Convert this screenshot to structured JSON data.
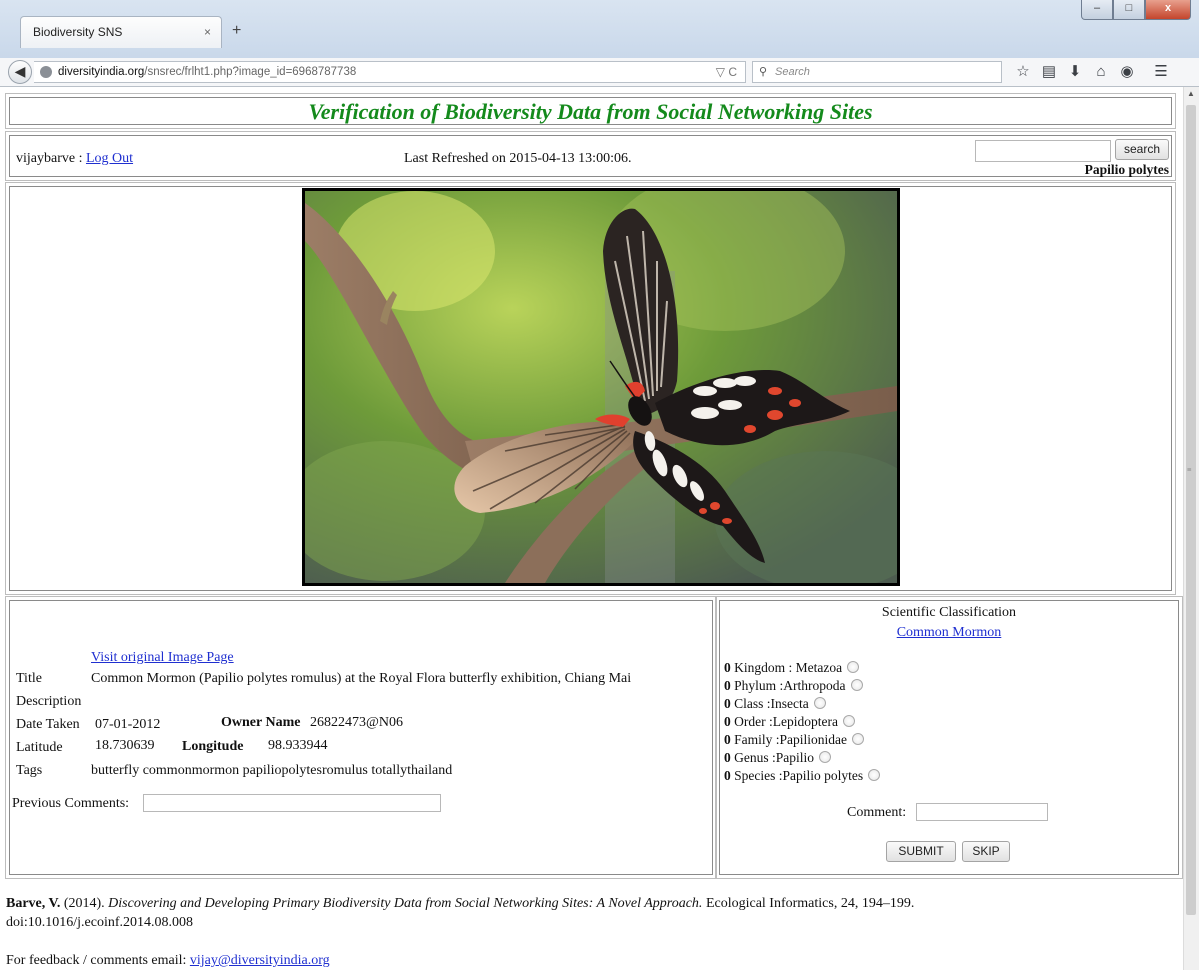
{
  "browser": {
    "tab_title": "Biodiversity SNS",
    "tab_close": "×",
    "new_tab": "+",
    "url_host": "diversityindia.org",
    "url_path": "/snsrec/frlht1.php?image_id=6968787738",
    "url_actions": "▽ C",
    "search_placeholder": "Search",
    "window_buttons": {
      "minimize": "–",
      "maximize": "□",
      "close": "x"
    }
  },
  "header": {
    "title": "Verification of Biodiversity Data from Social Networking Sites",
    "username": "vijaybarve :",
    "logout": "Log Out",
    "last_refreshed": "Last Refreshed on 2015-04-13 13:00:06.",
    "search_button": "search",
    "search_value": "",
    "current_species": "Papilio polytes"
  },
  "photo": {
    "subject": "butterfly-photo"
  },
  "details": {
    "visit_link": "Visit original Image Page",
    "title_label": "Title",
    "title_value": "Common Mormon (Papilio polytes romulus) at the Royal Flora butterfly exhibition, Chiang Mai",
    "description_label": "Description",
    "date_label": "Date Taken",
    "date_value": "07-01-2012",
    "owner_label": "Owner Name",
    "owner_value": "26822473@N06",
    "latitude_label": "Latitude",
    "latitude_value": "18.730639",
    "longitude_label": "Longitude",
    "longitude_value": "98.933944",
    "tags_label": "Tags",
    "tags_value": "butterfly commonmormon papiliopolytesromulus totallythailand",
    "prev_comments_label": "Previous Comments:",
    "prev_comments_value": ""
  },
  "classification": {
    "heading": "Scientific Classification",
    "common_name": "Common Mormon",
    "ranks": [
      {
        "count": "0",
        "label": "Kingdom : Metazoa"
      },
      {
        "count": "0",
        "label": "Phylum :Arthropoda"
      },
      {
        "count": "0",
        "label": "Class :Insecta"
      },
      {
        "count": "0",
        "label": "Order :Lepidoptera"
      },
      {
        "count": "0",
        "label": "Family :Papilionidae"
      },
      {
        "count": "0",
        "label": "Genus :Papilio"
      },
      {
        "count": "0",
        "label": "Species :Papilio polytes"
      }
    ],
    "comment_label": "Comment:",
    "submit": "SUBMIT",
    "skip": "SKIP"
  },
  "footer": {
    "author": "Barve, V.",
    "year": " (2014). ",
    "paper_title": "Discovering and Developing Primary Biodiversity Data from Social Networking Sites: A Novel Approach.",
    "journal": " Ecological Informatics, 24, 194–199.",
    "doi": "doi:10.1016/j.ecoinf.2014.08.008",
    "feedback_label": "For feedback / comments email: ",
    "email": "vijay@diversityindia.org"
  },
  "colors": {
    "title_green": "#148a1c",
    "link_blue": "#1f2fd0"
  }
}
